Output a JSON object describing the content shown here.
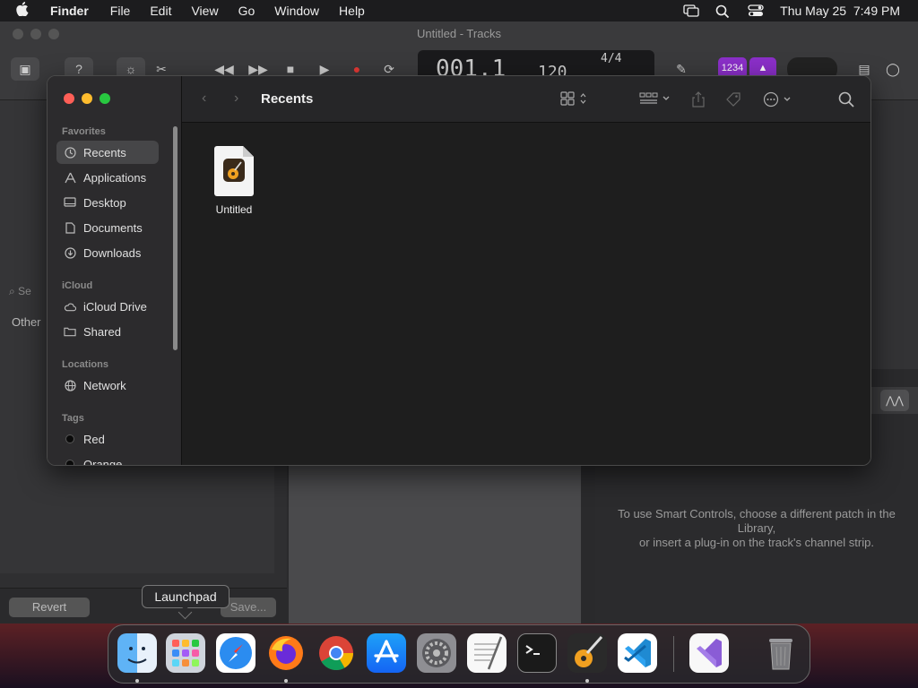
{
  "menubar": {
    "apple_icon": "apple-icon",
    "items": [
      "Finder",
      "File",
      "Edit",
      "View",
      "Go",
      "Window",
      "Help"
    ],
    "datetime": "Thu May 25  7:49 PM",
    "status_icons": [
      "screen-mirroring-icon",
      "search-icon",
      "control-center-icon"
    ]
  },
  "garageband": {
    "title": "Untitled - Tracks",
    "lcd": {
      "position": "001.1",
      "tempo": "120",
      "signature": "4/4"
    },
    "badge_count": "1234",
    "search_placeholder": "Se",
    "other_label": "Other",
    "revert_label": "Revert",
    "save_label": "Save...",
    "smart_controls_text": "To use Smart Controls, choose a different patch in the Library,\nor insert a plug-in on the track's channel strip."
  },
  "finder": {
    "title": "Recents",
    "sidebar": {
      "favorites_label": "Favorites",
      "favorites": [
        {
          "label": "Recents",
          "icon": "clock-icon"
        },
        {
          "label": "Applications",
          "icon": "applications-icon"
        },
        {
          "label": "Desktop",
          "icon": "desktop-icon"
        },
        {
          "label": "Documents",
          "icon": "document-icon"
        },
        {
          "label": "Downloads",
          "icon": "download-icon"
        }
      ],
      "icloud_label": "iCloud",
      "icloud": [
        {
          "label": "iCloud Drive",
          "icon": "cloud-icon"
        },
        {
          "label": "Shared",
          "icon": "shared-folder-icon"
        }
      ],
      "locations_label": "Locations",
      "locations": [
        {
          "label": "Network",
          "icon": "globe-icon"
        }
      ],
      "tags_label": "Tags",
      "tags": [
        {
          "label": "Red",
          "icon": "tag-dot-icon"
        },
        {
          "label": "Orange",
          "icon": "tag-dot-icon"
        }
      ]
    },
    "files": [
      {
        "name": "Untitled",
        "icon": "garageband-file-icon"
      }
    ]
  },
  "dock": {
    "tooltip": "Launchpad",
    "apps": [
      "Finder",
      "Launchpad",
      "Safari",
      "Firefox",
      "Chrome",
      "App Store",
      "System Settings",
      "TextEdit",
      "Terminal",
      "GarageBand",
      "Visual Studio Code",
      "Visual Studio",
      "Trash"
    ]
  }
}
